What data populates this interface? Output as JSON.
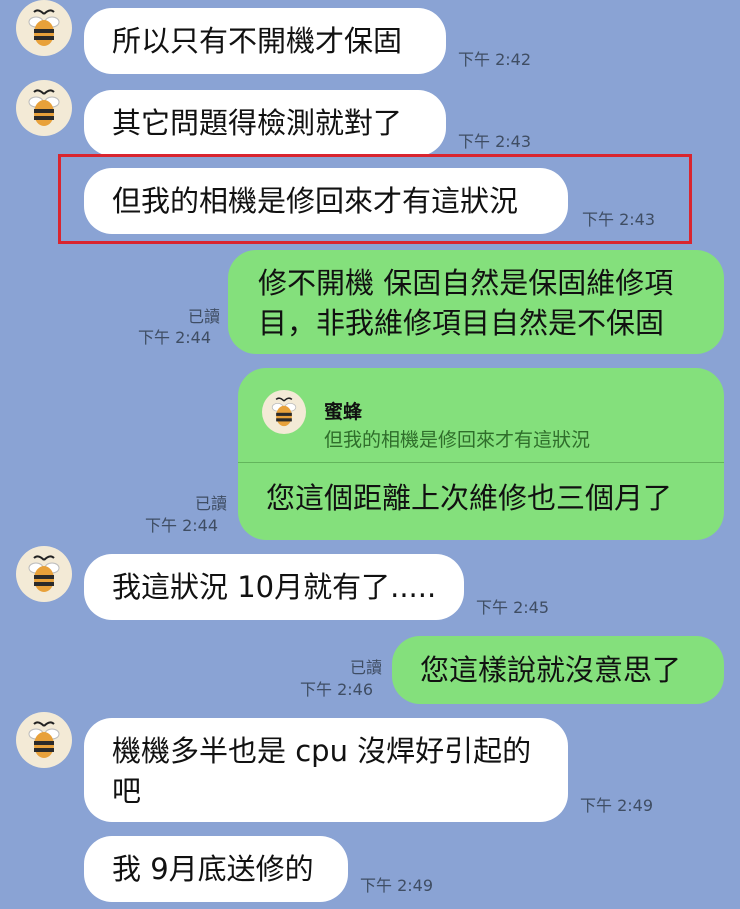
{
  "chat": {
    "contact_name": "蜜蜂",
    "colors": {
      "background": "#8aa3d4",
      "incoming_bubble": "#ffffff",
      "outgoing_bubble": "#84e07c",
      "highlight": "#d9252f"
    },
    "avatar_icon": "bee-icon",
    "messages": [
      {
        "text": "所以只有不開機才保固",
        "time": "下午 2:42"
      },
      {
        "text": "其它問題得檢測就對了",
        "time": "下午 2:43"
      },
      {
        "text": "但我的相機是修回來才有這狀況",
        "time": "下午 2:43"
      },
      {
        "lines": [
          "修不開機 保固自然是保固維修項",
          "目，非我維修項目自然是不保固"
        ],
        "read": "已讀",
        "time": "下午 2:44"
      },
      {
        "quote_name": "蜜蜂",
        "quote_text": "但我的相機是修回來才有這狀況",
        "text": "您這個距離上次維修也三個月了",
        "read": "已讀",
        "time": "下午 2:44"
      },
      {
        "text": "我這狀況 10月就有了.....",
        "time": "下午 2:45"
      },
      {
        "text": "您這樣說就沒意思了",
        "read": "已讀",
        "time": "下午 2:46"
      },
      {
        "lines": [
          "機機多半也是 cpu 沒焊好引起的",
          "吧"
        ],
        "time": "下午 2:49"
      },
      {
        "text": "我 9月底送修的",
        "time": "下午 2:49"
      }
    ]
  }
}
